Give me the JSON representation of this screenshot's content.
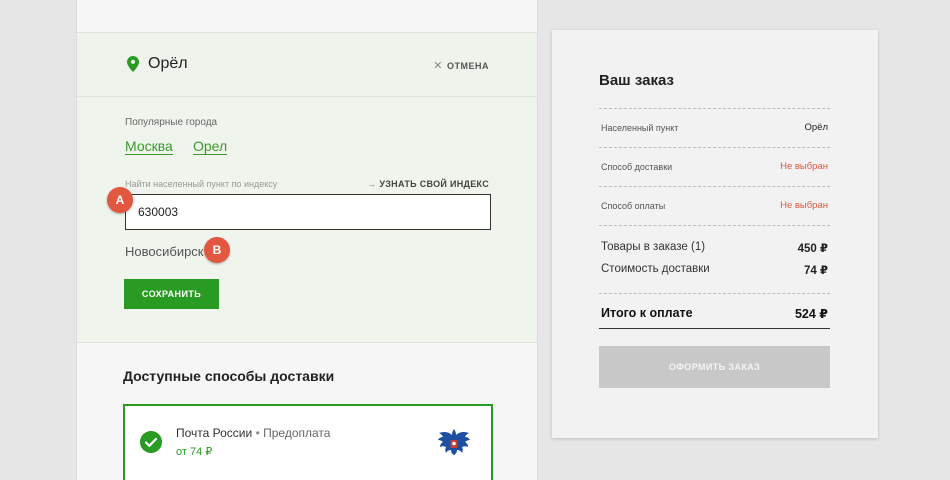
{
  "location": {
    "current_city": "Орёл",
    "cancel_label": "ОТМЕНА"
  },
  "form": {
    "popular_label": "Популярные города",
    "popular_cities": [
      "Москва",
      "Орел"
    ],
    "index_label": "Найти населенный пункт по индексу",
    "find_index_label": "УЗНАТЬ СВОЙ ИНДЕКС",
    "index_value": "630003",
    "suggestion": "Новосибирск",
    "save_label": "СОХРАНИТЬ"
  },
  "markers": [
    "A",
    "B"
  ],
  "delivery": {
    "title": "Доступные способы доставки",
    "option_name": "Почта России",
    "option_type": "Предоплата",
    "option_price": "от 74 ₽"
  },
  "order": {
    "title": "Ваш заказ",
    "settlement_label": "Населенный пункт",
    "settlement_value": "Орёл",
    "delivery_label": "Способ доставки",
    "delivery_value": "Не выбран",
    "payment_label": "Способ оплаты",
    "payment_value": "Не выбран",
    "goods_label": "Товары в заказе (1)",
    "goods_value": "450 ₽",
    "shipping_label": "Стоимость доставки",
    "shipping_value": "74 ₽",
    "total_label": "Итого к оплате",
    "total_value": "524 ₽",
    "checkout_label": "ОФОРМИТЬ ЗАКАЗ"
  },
  "colors": {
    "accent": "#2a9b22",
    "link": "#3a9b2b",
    "warning": "#e2573f",
    "disabled": "#c8c8c8"
  }
}
